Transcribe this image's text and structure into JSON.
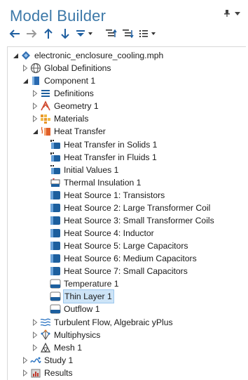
{
  "panel": {
    "title": "Model Builder"
  },
  "tree": [
    {
      "label": "electronic_enclosure_cooling.mph",
      "icon": "model-file-icon",
      "toggle": "expanded"
    },
    {
      "label": "Global Definitions",
      "icon": "globe-icon",
      "toggle": "collapsed"
    },
    {
      "label": "Component 1",
      "icon": "component-icon",
      "toggle": "expanded"
    },
    {
      "label": "Definitions",
      "icon": "definitions-icon",
      "toggle": "collapsed"
    },
    {
      "label": "Geometry 1",
      "icon": "geometry-icon",
      "toggle": "collapsed"
    },
    {
      "label": "Materials",
      "icon": "materials-icon",
      "toggle": "collapsed"
    },
    {
      "label": "Heat Transfer",
      "icon": "heat-transfer-icon",
      "toggle": "expanded"
    },
    {
      "label": "Heat Transfer in Solids 1",
      "icon": "heat-transfer-solids-icon",
      "toggle": "none"
    },
    {
      "label": "Heat Transfer in Fluids 1",
      "icon": "heat-transfer-fluids-icon",
      "toggle": "none"
    },
    {
      "label": "Initial Values 1",
      "icon": "initial-values-icon",
      "toggle": "none"
    },
    {
      "label": "Thermal Insulation 1",
      "icon": "thermal-insulation-icon",
      "toggle": "none"
    },
    {
      "label": "Heat Source 1: Transistors",
      "icon": "heat-source-icon",
      "toggle": "none"
    },
    {
      "label": "Heat Source 2: Large Transformer Coil",
      "icon": "heat-source-icon",
      "toggle": "none"
    },
    {
      "label": "Heat Source 3: Small Transformer Coils",
      "icon": "heat-source-icon",
      "toggle": "none"
    },
    {
      "label": "Heat Source 4: Inductor",
      "icon": "heat-source-icon",
      "toggle": "none"
    },
    {
      "label": "Heat Source 5: Large Capacitors",
      "icon": "heat-source-icon",
      "toggle": "none"
    },
    {
      "label": "Heat Source 6: Medium Capacitors",
      "icon": "heat-source-icon",
      "toggle": "none"
    },
    {
      "label": "Heat Source 7: Small Capacitors",
      "icon": "heat-source-icon",
      "toggle": "none"
    },
    {
      "label": "Temperature 1",
      "icon": "boundary-condition-icon",
      "toggle": "none"
    },
    {
      "label": "Thin Layer 1",
      "icon": "boundary-condition-icon",
      "toggle": "none",
      "selected": true
    },
    {
      "label": "Outflow 1",
      "icon": "boundary-condition-icon",
      "toggle": "none"
    },
    {
      "label": "Turbulent Flow, Algebraic yPlus",
      "icon": "turbulent-flow-icon",
      "toggle": "collapsed"
    },
    {
      "label": "Multiphysics",
      "icon": "multiphysics-icon",
      "toggle": "collapsed"
    },
    {
      "label": "Mesh 1",
      "icon": "mesh-icon",
      "toggle": "collapsed"
    },
    {
      "label": "Study 1",
      "icon": "study-icon",
      "toggle": "collapsed"
    },
    {
      "label": "Results",
      "icon": "results-icon",
      "toggle": "collapsed"
    }
  ],
  "colors": {
    "title": "#3c78a8",
    "selection": "#cde4f7",
    "node_blue": "#1d5f9e"
  }
}
